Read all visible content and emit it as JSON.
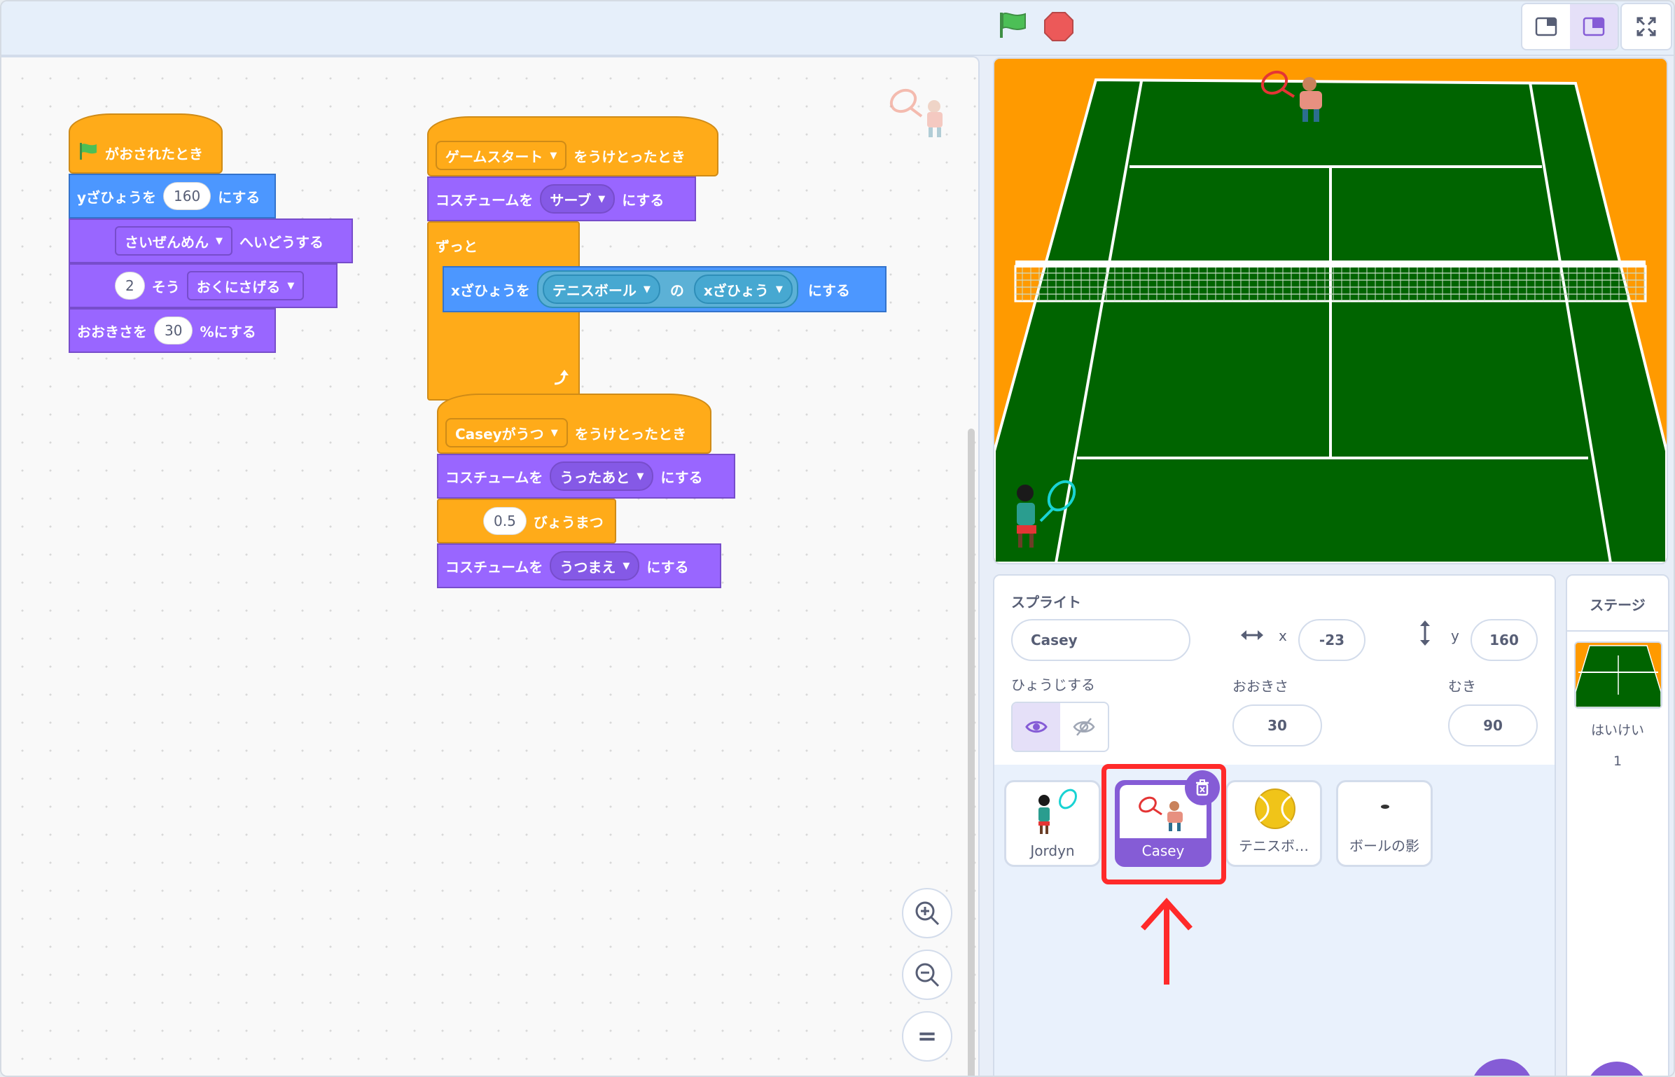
{
  "toolbar": {
    "icons": [
      "green-flag-icon",
      "stop-icon",
      "small-stage-icon",
      "large-stage-icon",
      "fullscreen-icon"
    ],
    "colors": {
      "flag": "#4cbf56",
      "stop": "#ec5959",
      "accent": "#855cd6"
    }
  },
  "scripts": {
    "s1": {
      "hat_label": "がおされたとき",
      "set_y_label": "yざひょうを",
      "set_y_value": "160",
      "set_y_suffix": "にする",
      "goto_menu": "さいぜんめん",
      "goto_suffix": "へいどうする",
      "layer_value": "2",
      "layer_mid": "そう",
      "layer_menu": "おくにさげる",
      "size_label": "おおきさを",
      "size_value": "30",
      "size_suffix": "%にする"
    },
    "s2": {
      "hat_menu": "ゲームスタート",
      "hat_suffix": "をうけとったとき",
      "costume_label": "コスチュームを",
      "costume_menu": "サーブ",
      "costume_suffix": "にする",
      "forever_label": "ずっと",
      "set_x_label": "xざひょうを",
      "of_sprite": "テニスボール",
      "of_mid": "の",
      "of_prop": "xざひょう",
      "set_x_suffix": "にする"
    },
    "s3": {
      "hat_menu": "Caseyがうつ",
      "hat_suffix": "をうけとったとき",
      "costume1_label": "コスチュームを",
      "costume1_menu": "うったあと",
      "costume1_suffix": "にする",
      "wait_value": "0.5",
      "wait_suffix": "びょうまつ",
      "costume2_label": "コスチュームを",
      "costume2_menu": "うつまえ",
      "costume2_suffix": "にする"
    }
  },
  "zoom": {
    "icons": [
      "zoom-in-icon",
      "zoom-out-icon",
      "zoom-reset-icon"
    ],
    "reset_glyph": "="
  },
  "sprite_info": {
    "sprite_label": "スプライト",
    "sprite_name": "Casey",
    "x_label": "x",
    "x_value": "-23",
    "y_label": "y",
    "y_value": "160",
    "show_label": "ひょうじする",
    "size_label": "おおきさ",
    "size_value": "30",
    "direction_label": "むき",
    "direction_value": "90"
  },
  "sprites": [
    {
      "name": "Jordyn",
      "selected": false
    },
    {
      "name": "Casey",
      "selected": true
    },
    {
      "name": "テニスボ…",
      "selected": false
    },
    {
      "name": "ボールの影",
      "selected": false
    }
  ],
  "stage_panel": {
    "title": "ステージ",
    "backdrop_label": "はいけい",
    "backdrop_count": "1"
  },
  "stage_colors": {
    "court": "#006400",
    "surround": "#ff9a00",
    "lines": "#ffffff"
  }
}
